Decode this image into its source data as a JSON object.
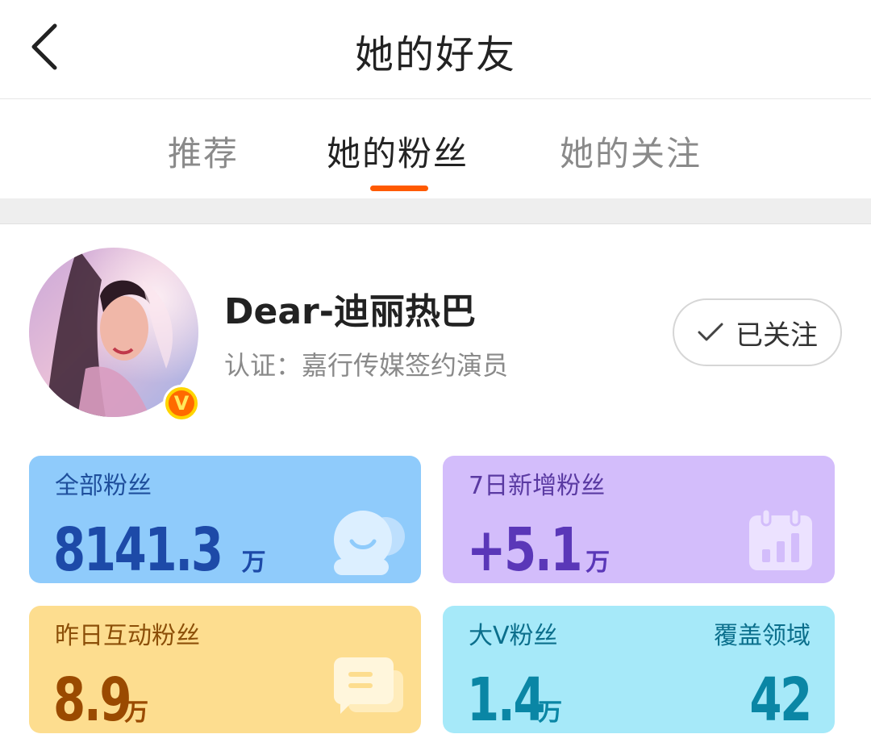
{
  "header": {
    "title": "她的好友"
  },
  "tabs": [
    {
      "label": "推荐"
    },
    {
      "label": "她的粉丝"
    },
    {
      "label": "她的关注"
    }
  ],
  "profile": {
    "name": "Dear-迪丽热巴",
    "verification": "认证：嘉行传媒签约演员",
    "follow_label": "已关注"
  },
  "stats": {
    "all_fans": {
      "label": "全部粉丝",
      "value": "8141.3",
      "unit": "万"
    },
    "new_fans_7d": {
      "label": "7日新增粉丝",
      "value": "+5.1",
      "unit": "万"
    },
    "active_fans_yesterday": {
      "label": "昨日互动粉丝",
      "value": "8.9",
      "unit": "万"
    },
    "big_v_fans": {
      "label": "大V粉丝",
      "value": "1.4",
      "unit": "万",
      "coverage_label": "覆盖领域",
      "coverage_value": "42"
    }
  },
  "colors": {
    "accent": "#ff5a00",
    "card_blue_bg": "#8fcbfb",
    "card_purple_bg": "#d3bdfb",
    "card_yellow_bg": "#fddd8f",
    "card_cyan_bg": "#a6e9f9"
  }
}
